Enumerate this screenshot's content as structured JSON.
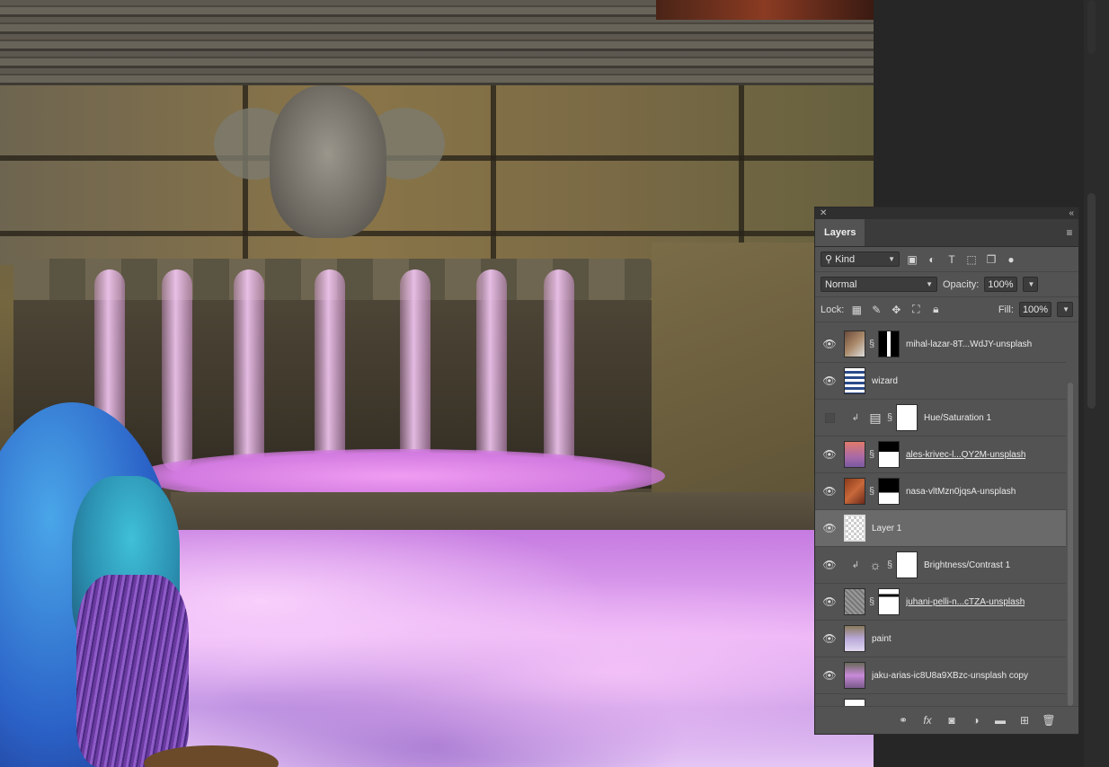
{
  "panel": {
    "tab_label": "Layers",
    "filter": {
      "kind_label": "Kind"
    },
    "blend_mode": "Normal",
    "opacity_label": "Opacity:",
    "opacity_value": "100%",
    "lock_label": "Lock:",
    "fill_label": "Fill:",
    "fill_value": "100%"
  },
  "layers": [
    {
      "name": "mihal-lazar-8T...WdJY-unsplash",
      "visible": true,
      "has_mask": true
    },
    {
      "name": "wizard",
      "visible": true,
      "has_mask": false
    },
    {
      "name": "Hue/Saturation 1",
      "visible": false,
      "adjustment": "hue-saturation",
      "clipped": true
    },
    {
      "name": "ales-krivec-l...QY2M-unsplash",
      "visible": true,
      "has_mask": true,
      "underlined": true
    },
    {
      "name": "nasa-vltMzn0jqsA-unsplash",
      "visible": true,
      "has_mask": true
    },
    {
      "name": "Layer 1",
      "visible": true,
      "selected": true
    },
    {
      "name": "Brightness/Contrast 1",
      "visible": true,
      "adjustment": "brightness-contrast",
      "clipped": true
    },
    {
      "name": "juhani-pelli-n...cTZA-unsplash",
      "visible": true,
      "has_mask": true,
      "underlined": true
    },
    {
      "name": "paint",
      "visible": true,
      "has_mask": false
    },
    {
      "name": "jaku-arias-ic8U8a9XBzc-unsplash copy",
      "visible": true,
      "has_mask": false
    }
  ],
  "colors": {
    "panel_bg": "#535353",
    "selected_row": "#6a6a6a",
    "app_bg": "#262626"
  },
  "icons": [
    "eye-icon",
    "link-icon",
    "fx-icon",
    "mask-icon",
    "adjustment-icon",
    "folder-icon",
    "new-layer-icon",
    "trash-icon"
  ]
}
